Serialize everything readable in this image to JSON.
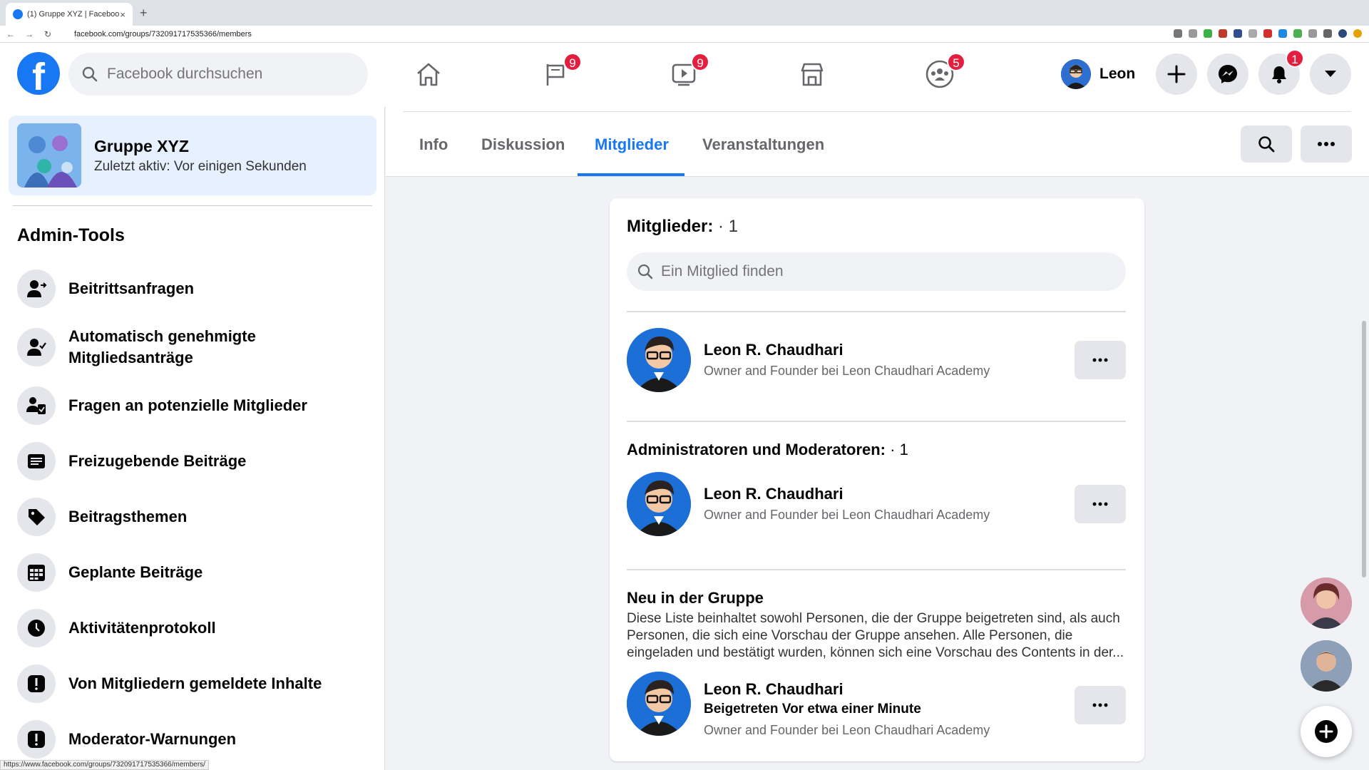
{
  "browser": {
    "tab_title": "(1) Gruppe XYZ | Facebook",
    "tab_close": "×",
    "new_tab": "+",
    "back": "←",
    "forward": "→",
    "reload": "↻",
    "url": "facebook.com/groups/732091717535366/members",
    "status_url": "https://www.facebook.com/groups/732091717535366/members/"
  },
  "header": {
    "logo": "f",
    "search_placeholder": "Facebook durchsuchen",
    "badges": {
      "pages": "9",
      "watch": "9",
      "groups": "5",
      "notifications": "1"
    },
    "profile_name": "Leon"
  },
  "sidebar": {
    "group_name": "Gruppe XYZ",
    "group_status": "Zuletzt aktiv: Vor einigen Sekunden",
    "admin_tools_title": "Admin-Tools",
    "items": [
      {
        "label": "Beitrittsanfragen",
        "icon": "person-arrow-icon"
      },
      {
        "label": "Automatisch genehmigte Mitgliedsanträge",
        "icon": "person-check-icon"
      },
      {
        "label": "Fragen an potenzielle Mitglieder",
        "icon": "person-clipboard-icon"
      },
      {
        "label": "Freizugebende Beiträge",
        "icon": "post-list-icon"
      },
      {
        "label": "Beitragsthemen",
        "icon": "tag-icon"
      },
      {
        "label": "Geplante Beiträge",
        "icon": "calendar-icon"
      },
      {
        "label": "Aktivitätenprotokoll",
        "icon": "clock-icon"
      },
      {
        "label": "Von Mitgliedern gemeldete Inhalte",
        "icon": "alert-icon"
      },
      {
        "label": "Moderator-Warnungen",
        "icon": "alert-icon"
      }
    ]
  },
  "group_tabs": {
    "info": "Info",
    "discussion": "Diskussion",
    "members": "Mitglieder",
    "events": "Veranstaltungen"
  },
  "members_card": {
    "title": "Mitglieder:",
    "count": " · 1",
    "search_placeholder": "Ein Mitglied finden",
    "dots": "···",
    "member_1": {
      "name": "Leon R. Chaudhari",
      "subtitle": "Owner and Founder bei Leon Chaudhari Academy"
    },
    "admins_title": "Administratoren und Moderatoren:",
    "admins_count": " · 1",
    "admin_1": {
      "name": "Leon R. Chaudhari",
      "subtitle": "Owner and Founder bei Leon Chaudhari Academy"
    },
    "new_title": "Neu in der Gruppe",
    "new_description": "Diese Liste beinhaltet sowohl Personen, die der Gruppe beigetreten sind, als auch Personen, die sich eine Vorschau der Gruppe ansehen. Alle Personen, die eingeladen und bestätigt wurden, können sich eine Vorschau des Contents in der...",
    "new_1": {
      "name": "Leon R. Chaudhari",
      "joined": "Beigetreten Vor etwa einer Minute",
      "subtitle": "Owner and Founder bei Leon Chaudhari Academy"
    }
  },
  "colors": {
    "facebook_blue": "#1877f2",
    "badge_red": "#e41e3f",
    "page_bg": "#f0f2f5"
  }
}
